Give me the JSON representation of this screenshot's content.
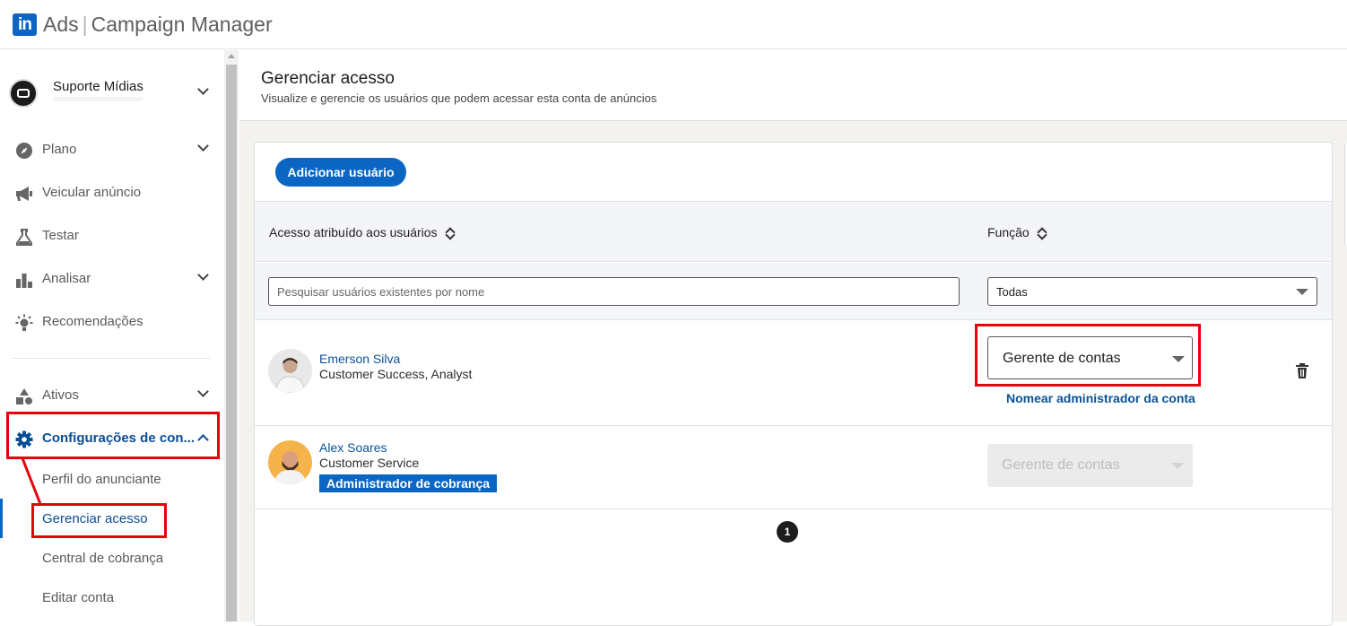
{
  "app": {
    "logo_text": "in",
    "product": "Ads",
    "title": "Campaign Manager"
  },
  "account": {
    "name": "Suporte Mídias"
  },
  "nav": {
    "plan": "Plano",
    "advertise": "Veicular anúncio",
    "test": "Testar",
    "analyze": "Analisar",
    "recommendations": "Recomendações",
    "assets": "Ativos",
    "settings": "Configurações de con...",
    "sub": {
      "advertiser_profile": "Perfil do anunciante",
      "manage_access": "Gerenciar acesso",
      "billing_center": "Central de cobrança",
      "edit_account": "Editar conta"
    }
  },
  "page": {
    "title": "Gerenciar acesso",
    "subtitle": "Visualize e gerencie os usuários que podem acessar esta conta de anúncios",
    "add_button": "Adicionar usuário",
    "columns": {
      "users": "Acesso atribuído aos usuários",
      "role": "Função"
    },
    "search_placeholder": "Pesquisar usuários existentes por nome",
    "role_filter": "Todas",
    "users": [
      {
        "name": "Emerson Silva",
        "title": "Customer Success, Analyst",
        "role": "Gerente de contas",
        "action_link": "Nomear administrador da conta"
      },
      {
        "name": "Alex Soares",
        "title": "Customer Service",
        "badge": "Administrador de cobrança",
        "role": "Gerente de contas"
      }
    ],
    "pagination": {
      "current": "1"
    }
  },
  "colors": {
    "brand": "#0a66c2",
    "highlight": "#e8000c",
    "active_nav": "#0a4d94"
  }
}
